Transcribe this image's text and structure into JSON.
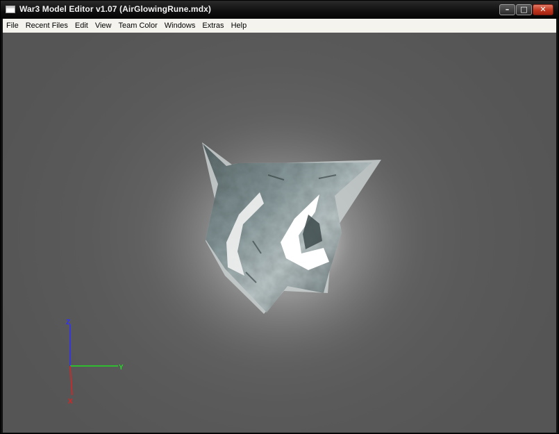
{
  "window": {
    "title": "War3 Model Editor v1.07 (AirGlowingRune.mdx)",
    "minimize_glyph": "–",
    "maximize_glyph": "□",
    "close_glyph": "✕"
  },
  "menu": {
    "items": [
      "File",
      "Recent Files",
      "Edit",
      "View",
      "Team Color",
      "Windows",
      "Extras",
      "Help"
    ]
  },
  "viewport": {
    "background_color": "#5e5e5e",
    "axes": {
      "z_label": "Z",
      "y_label": "Y",
      "x_label": "X",
      "z_color": "#2d2dff",
      "y_color": "#22dd22",
      "x_color": "#dd2222"
    },
    "model_icon": "glowing-rune-model"
  }
}
